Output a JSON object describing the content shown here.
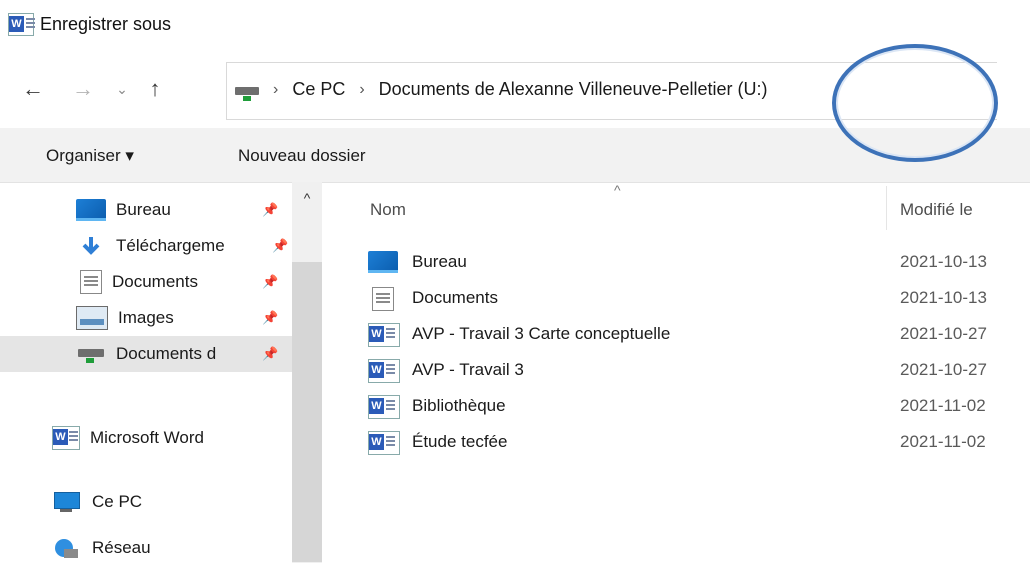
{
  "window": {
    "title": "Enregistrer sous"
  },
  "nav_buttons": {
    "back": "←",
    "forward": "→",
    "recent": "⌄",
    "up": "↑"
  },
  "address": {
    "crumbs": [
      "Ce PC",
      "Documents de Alexanne Villeneuve-Pelletier (U:)"
    ],
    "separator": "›"
  },
  "toolbar": {
    "organize": "Organiser ▾",
    "new_folder": "Nouveau dossier"
  },
  "sidebar": {
    "scroll_up": "^",
    "pin": "📌",
    "items": [
      {
        "label": "Bureau",
        "icon": "desktop-icon",
        "pinned": true
      },
      {
        "label": "Téléchargeme",
        "icon": "download-icon",
        "pinned": true
      },
      {
        "label": "Documents",
        "icon": "documents-icon",
        "pinned": true
      },
      {
        "label": "Images",
        "icon": "images-icon",
        "pinned": true
      },
      {
        "label": "Documents d",
        "icon": "network-drive-icon",
        "pinned": true
      },
      {
        "label": "Microsoft Word",
        "icon": "word-icon",
        "pinned": false
      },
      {
        "label": "Ce PC",
        "icon": "computer-icon",
        "pinned": false
      },
      {
        "label": "Réseau",
        "icon": "network-icon",
        "pinned": false
      }
    ]
  },
  "columns": {
    "name": "Nom",
    "modified": "Modifié le",
    "sort_indicator": "^"
  },
  "files": [
    {
      "name": "Bureau",
      "modified": "2021-10-13",
      "icon": "desktop-folder-icon"
    },
    {
      "name": "Documents",
      "modified": "2021-10-13",
      "icon": "documents-folder-icon"
    },
    {
      "name": "AVP - Travail 3 Carte conceptuelle",
      "modified": "2021-10-27",
      "icon": "word-doc-icon"
    },
    {
      "name": "AVP - Travail 3",
      "modified": "2021-10-27",
      "icon": "word-doc-icon"
    },
    {
      "name": "Bibliothèque",
      "modified": "2021-11-02",
      "icon": "word-doc-icon"
    },
    {
      "name": "Étude tecfée",
      "modified": "2021-11-02",
      "icon": "word-doc-icon"
    }
  ],
  "colors": {
    "accent": "#2b5bb8",
    "annotation": "#3d72b8",
    "toolbar_bg": "#f2f2f2"
  }
}
